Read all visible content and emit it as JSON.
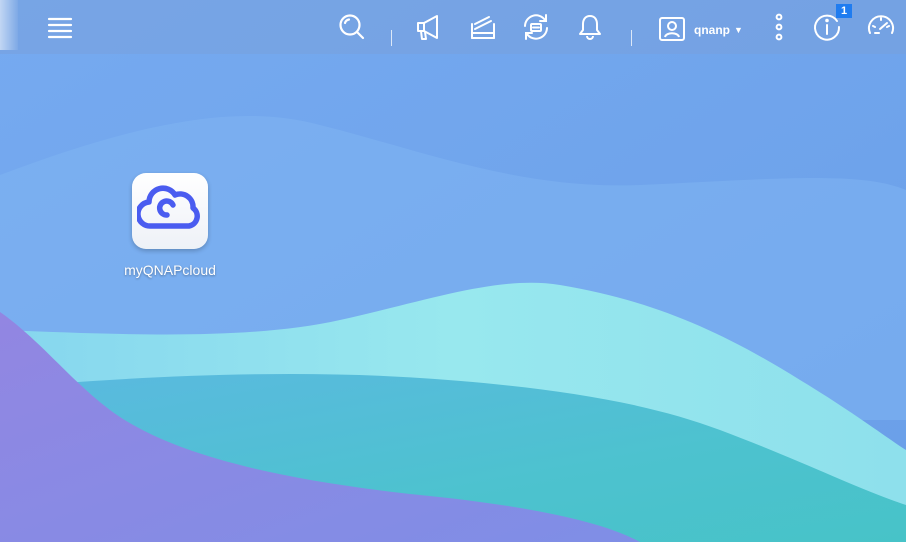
{
  "taskbar": {
    "menu_icon": "hamburger-menu-icon",
    "search_icon": "search-icon",
    "announcement_icon": "megaphone-icon",
    "tasks_icon": "background-tasks-icon",
    "sync_icon": "external-device-sync-icon",
    "notification_icon": "bell-icon",
    "user": {
      "icon": "user-account-icon",
      "name": "qnanp"
    },
    "more_icon": "more-vertical-icon",
    "info": {
      "icon": "info-icon",
      "badge_count": "1"
    },
    "dashboard_icon": "dashboard-gauge-icon"
  },
  "desktop": {
    "apps": [
      {
        "label": "myQNAPcloud",
        "icon": "myqnapcloud-cloud-icon",
        "accent_color": "#4a5cf0"
      }
    ]
  },
  "colors": {
    "sky_top": "#6fa6ee",
    "wave_light": "#97e6ee",
    "wave_teal": "#4fc5cc",
    "wave_purple": "#8e86e4",
    "badge": "#1f7cf0"
  }
}
